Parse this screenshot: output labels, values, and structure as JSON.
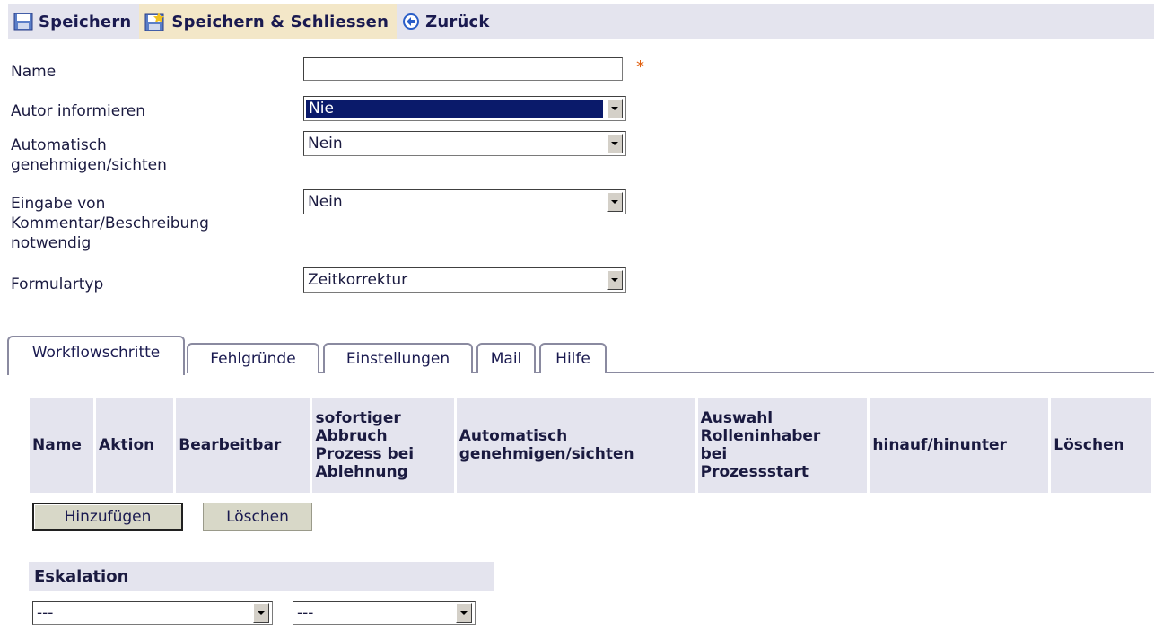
{
  "toolbar": {
    "save": "Speichern",
    "save_close": "Speichern & Schliessen",
    "back": "Zurück"
  },
  "form": {
    "name_label": "Name",
    "name_value": "",
    "required_marker": "*",
    "notify_author_label": "Autor informieren",
    "notify_author_value": "Nie",
    "auto_approve_label_1": "Automatisch",
    "auto_approve_label_2": "genehmigen/sichten",
    "auto_approve_value": "Nein",
    "comment_required_label_1": "Eingabe von",
    "comment_required_label_2": "Kommentar/Beschreibung",
    "comment_required_label_3": "notwendig",
    "comment_required_value": "Nein",
    "form_type_label": "Formulartyp",
    "form_type_value": "Zeitkorrektur"
  },
  "tabs": [
    "Workflowschritte",
    "Fehlgründe",
    "Einstellungen",
    "Mail",
    "Hilfe"
  ],
  "table": {
    "headers": {
      "name": "Name",
      "action": "Aktion",
      "editable": "Bearbeitbar",
      "abort": [
        "sofortiger",
        "Abbruch",
        "Prozess bei",
        "Ablehnung"
      ],
      "auto": [
        "Automatisch",
        "genehmigen/sichten"
      ],
      "role": [
        "Auswahl",
        "Rolleninhaber",
        "bei",
        "Prozessstart"
      ],
      "updown": "hinauf/hinunter",
      "delete": "Löschen"
    }
  },
  "buttons": {
    "add": "Hinzufügen",
    "delete": "Löschen"
  },
  "escalation": {
    "title": "Eskalation",
    "select1": "---",
    "select2": "---"
  },
  "colors": {
    "toolbar_bg": "#e4e4ee",
    "hover_bg": "#f3e7c8",
    "selected_bg": "#0a1a6a",
    "required": "#e06010"
  }
}
